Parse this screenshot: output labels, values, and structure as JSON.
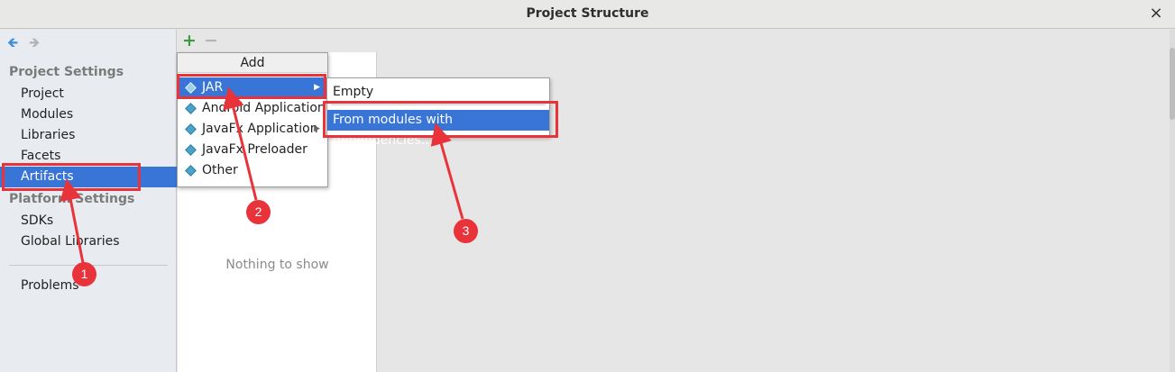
{
  "window": {
    "title": "Project Structure",
    "close_glyph": "×"
  },
  "sidebar": {
    "back_glyph": "🡸",
    "forward_glyph": "🡺",
    "project_settings_title": "Project Settings",
    "project_items": [
      "Project",
      "Modules",
      "Libraries",
      "Facets",
      "Artifacts"
    ],
    "selected_item": "Artifacts",
    "platform_settings_title": "Platform Settings",
    "platform_items": [
      "SDKs",
      "Global Libraries"
    ],
    "problems_label": "Problems"
  },
  "middle": {
    "add_glyph": "+",
    "remove_glyph": "−",
    "empty_text": "Nothing to show"
  },
  "add_menu": {
    "header": "Add",
    "items": [
      {
        "label": "JAR",
        "has_submenu": true,
        "active": true
      },
      {
        "label": "Android Application",
        "has_submenu": false
      },
      {
        "label": "JavaFx Application",
        "has_submenu": true
      },
      {
        "label": "JavaFx Preloader",
        "has_submenu": false
      },
      {
        "label": "Other",
        "has_submenu": false
      }
    ],
    "submenu_arrow_glyph": "▶"
  },
  "jar_submenu": {
    "items": [
      {
        "label": "Empty"
      },
      {
        "label": "From modules with dependencies...",
        "active": true
      }
    ]
  },
  "annotations": {
    "callouts": [
      "1",
      "2",
      "3"
    ],
    "highlight_color": "#e8333a"
  },
  "colors": {
    "selection": "#3875d7",
    "icon_accent": "#4ba3c9",
    "add_green": "#3d9c3d"
  }
}
